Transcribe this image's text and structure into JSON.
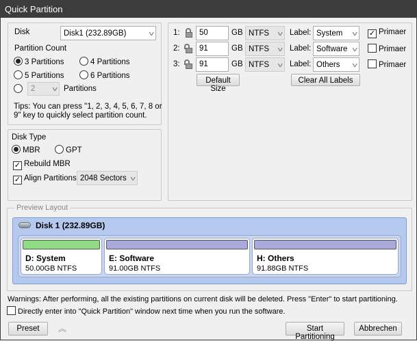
{
  "window": {
    "title": "Quick Partition"
  },
  "left": {
    "disk_label": "Disk",
    "disk_value": "Disk1 (232.89GB)",
    "partition_count_label": "Partition Count",
    "options": [
      "3 Partitions",
      "4 Partitions",
      "5 Partitions",
      "6 Partitions"
    ],
    "selected_option": "3 Partitions",
    "custom_count": "2",
    "custom_suffix": "Partitions",
    "tips_line1": "Tips: You can press \"1, 2, 3, 4, 5, 6, 7, 8 or",
    "tips_line2": "9\" key to quickly select partition count."
  },
  "disk_type": {
    "label": "Disk Type",
    "mbr": "MBR",
    "gpt": "GPT",
    "selected": "MBR",
    "rebuild_mbr": "Rebuild MBR",
    "rebuild_checked": true,
    "align": "Align Partitions:",
    "align_checked": true,
    "align_value": "2048 Sectors"
  },
  "partitions": [
    {
      "num": "1:",
      "locked": true,
      "size": "50",
      "unit": "GB",
      "fs": "NTFS",
      "label_text": "Label:",
      "label": "System",
      "primary_text": "Primaer",
      "primary": true
    },
    {
      "num": "2:",
      "locked": false,
      "size": "91",
      "unit": "GB",
      "fs": "NTFS",
      "label_text": "Label:",
      "label": "Software",
      "primary_text": "Primaer",
      "primary": false
    },
    {
      "num": "3:",
      "locked": false,
      "size": "91",
      "unit": "GB",
      "fs": "NTFS",
      "label_text": "Label:",
      "label": "Others",
      "primary_text": "Primaer",
      "primary": false
    }
  ],
  "buttons": {
    "default_size": "Default Size",
    "clear_labels": "Clear All Labels",
    "preset": "Preset",
    "start": "Start Partitioning",
    "cancel": "Abbrechen"
  },
  "preview": {
    "legend": "Preview Layout",
    "disk": "Disk 1 (232.89GB)",
    "parts": [
      {
        "name": "D: System",
        "size": "50.00GB NTFS",
        "color": "#8fdc85"
      },
      {
        "name": "E: Software",
        "size": "91.00GB NTFS",
        "color": "#a9a9dc"
      },
      {
        "name": "H: Others",
        "size": "91.88GB NTFS",
        "color": "#a9a9dc"
      }
    ]
  },
  "warning": "Warnings: After performing, all the existing partitions on current disk will be deleted. Press \"Enter\" to start partitioning.",
  "direct_enter": "Directly enter into \"Quick Partition\" window next time when you run the software."
}
